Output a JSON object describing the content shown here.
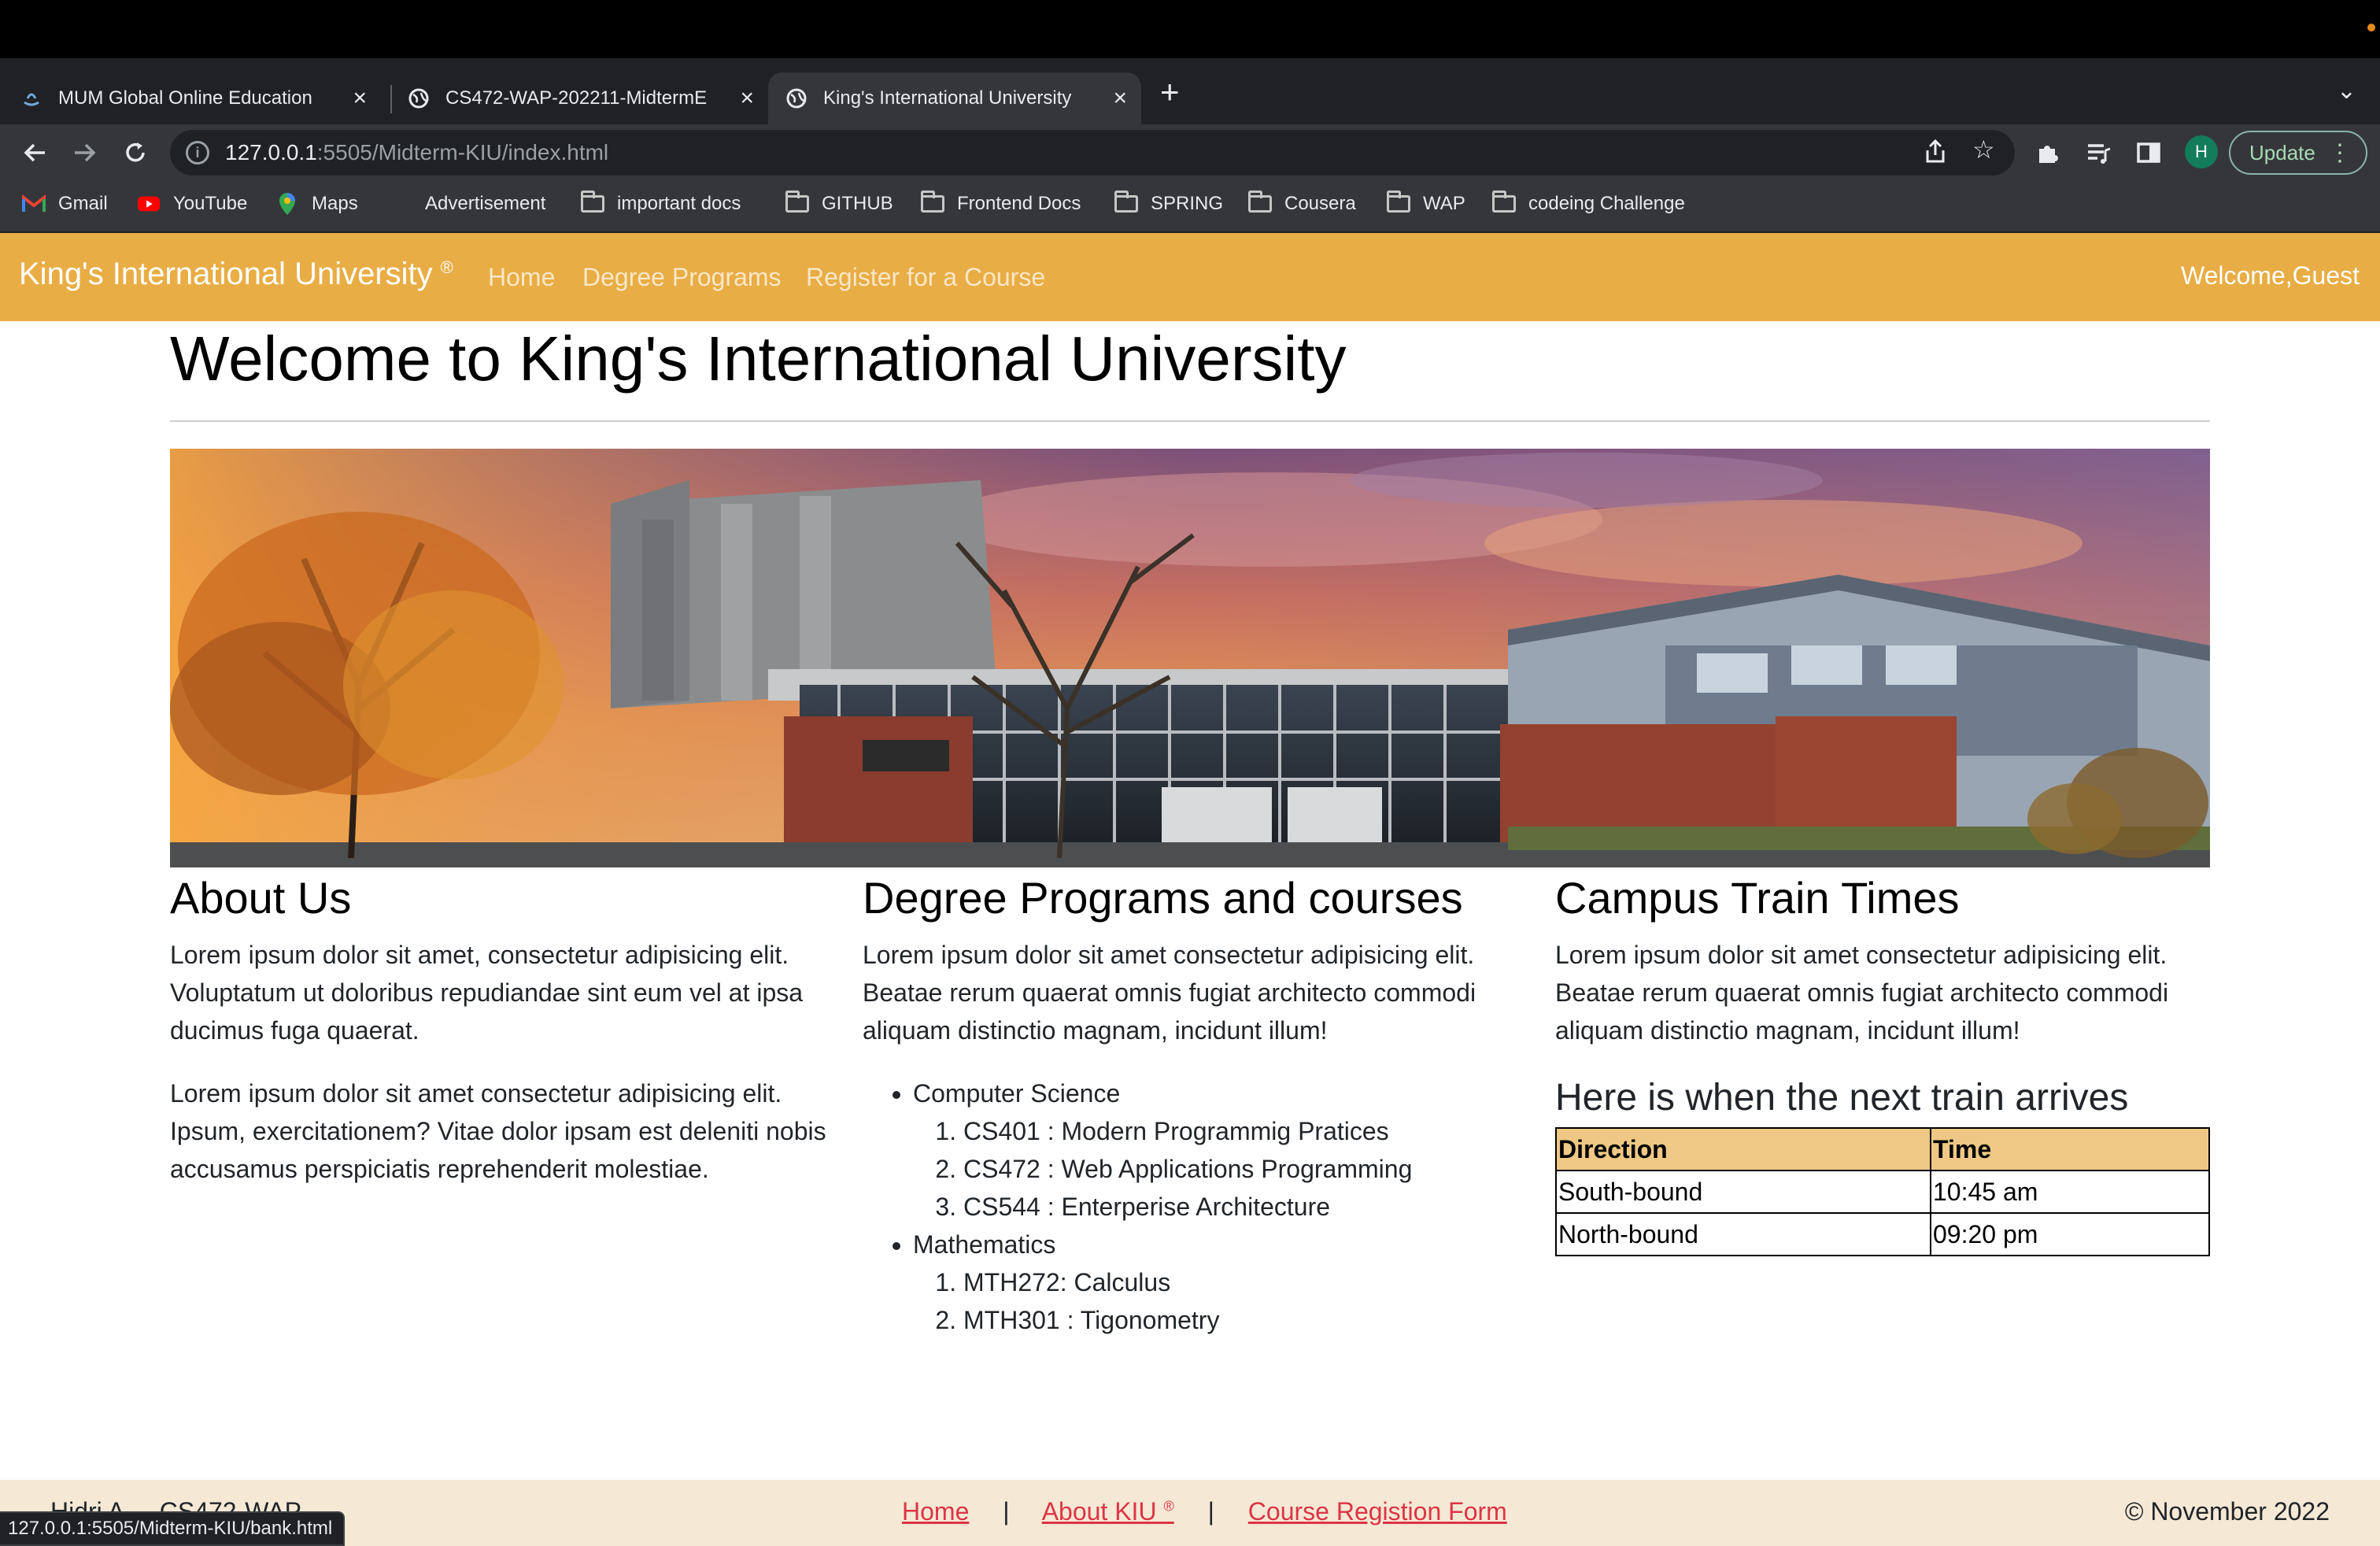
{
  "browser": {
    "tabs": [
      {
        "title": "MUM Global Online Education",
        "active": false,
        "icon": "cloud-icon"
      },
      {
        "title": "CS472-WAP-202211-MidtermE",
        "active": false,
        "icon": "globe-icon"
      },
      {
        "title": "King's International University",
        "active": true,
        "icon": "globe-icon"
      }
    ],
    "url_host": "127.0.0.1",
    "url_path": ":5505/Midterm-KIU/index.html",
    "profile_initial": "H",
    "update_label": "Update",
    "bookmarks": [
      {
        "label": "Gmail",
        "icon": "gmail-icon"
      },
      {
        "label": "YouTube",
        "icon": "youtube-icon"
      },
      {
        "label": "Maps",
        "icon": "maps-icon"
      },
      {
        "label": "Advertisement",
        "icon": "blank-icon"
      },
      {
        "label": "important docs",
        "icon": "folder-icon"
      },
      {
        "label": "GITHUB",
        "icon": "folder-icon"
      },
      {
        "label": "Frontend Docs",
        "icon": "folder-icon"
      },
      {
        "label": "SPRING",
        "icon": "folder-icon"
      },
      {
        "label": "Cousera",
        "icon": "folder-icon"
      },
      {
        "label": "WAP",
        "icon": "folder-icon"
      },
      {
        "label": "codeing Challenge",
        "icon": "folder-icon"
      }
    ],
    "status_url": "127.0.0.1:5505/Midterm-KIU/bank.html"
  },
  "site": {
    "brand": "King's International University",
    "brand_mark": "®",
    "nav": [
      "Home",
      "Degree Programs",
      "Register for a Course"
    ],
    "welcome": "Welcome,Guest",
    "heading": "Welcome to King's International University",
    "colors": {
      "nav_bg": "#e9ad45",
      "table_header": "#efc885",
      "footer_bg": "#f5e8d5",
      "footer_link": "#dc3545"
    }
  },
  "about": {
    "title": "About Us",
    "p1": "Lorem ipsum dolor sit amet, consectetur adipisicing elit. Voluptatum ut doloribus repudiandae sint eum vel at ipsa ducimus fuga quaerat.",
    "p2": "Lorem ipsum dolor sit amet consectetur adipisicing elit. Ipsum, exercitationem? Vitae dolor ipsam est deleniti nobis accusamus perspiciatis reprehenderit molestiae."
  },
  "programs": {
    "title": "Degree Programs and courses",
    "intro": "Lorem ipsum dolor sit amet consectetur adipisicing elit. Beatae rerum quaerat omnis fugiat architecto commodi aliquam distinctio magnam, incidunt illum!",
    "groups": [
      {
        "name": "Computer Science",
        "courses": [
          "CS401 : Modern Programmig Pratices",
          "CS472 : Web Applications Programming",
          "CS544 : Enterperise Architecture"
        ]
      },
      {
        "name": "Mathematics",
        "courses": [
          "MTH272: Calculus",
          "MTH301 : Tigonometry"
        ]
      }
    ]
  },
  "train": {
    "title": "Campus Train Times",
    "intro": "Lorem ipsum dolor sit amet consectetur adipisicing elit. Beatae rerum quaerat omnis fugiat architecto commodi aliquam distinctio magnam, incidunt illum!",
    "subtitle": "Here is when the next train arrives",
    "headers": [
      "Direction",
      "Time"
    ],
    "rows": [
      [
        "South-bound",
        "10:45 am"
      ],
      [
        "North-bound",
        "09:20 pm"
      ]
    ]
  },
  "footer": {
    "left": "Hidri A.... CS472-WAP",
    "links": [
      "Home",
      "About KIU",
      "Course Registion Form"
    ],
    "about_mark": "®",
    "separator": "|",
    "right": "© November 2022"
  }
}
